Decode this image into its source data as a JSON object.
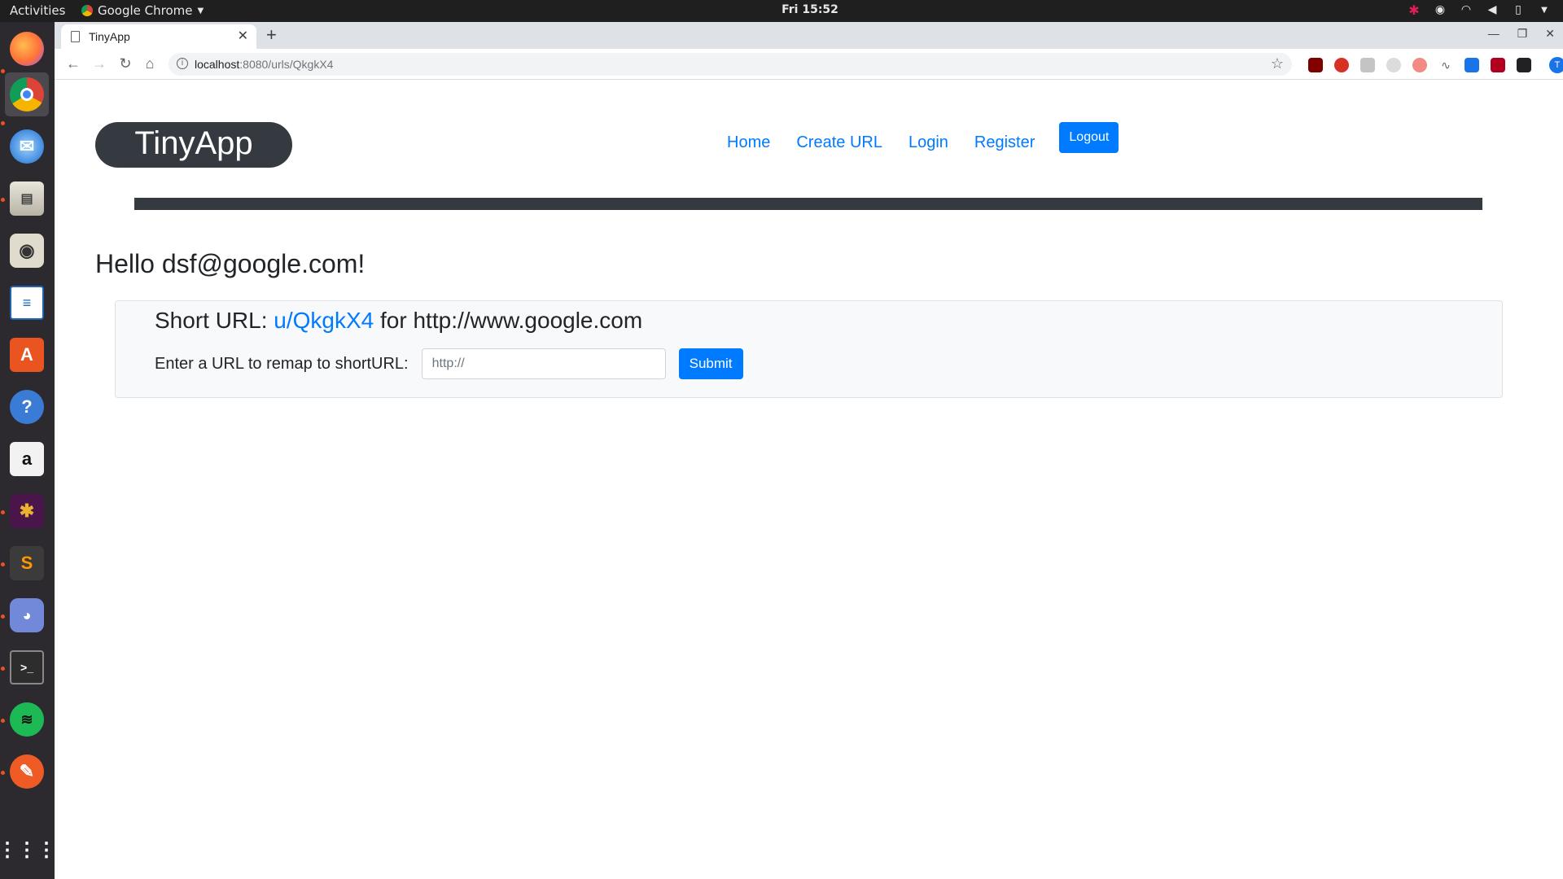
{
  "topbar": {
    "activities": "Activities",
    "app_name": "Google Chrome",
    "clock": "Fri 15:52"
  },
  "dock": {
    "apps": [
      "firefox",
      "chrome",
      "thunderbird",
      "files",
      "rhythmbox",
      "libreoffice-writer",
      "software-center",
      "help",
      "amazon",
      "slack",
      "sublime-text",
      "discord",
      "terminal",
      "spotify",
      "postman",
      "show-applications"
    ]
  },
  "browser": {
    "tab_title": "TinyApp",
    "url_host": "localhost",
    "url_rest": ":8080/urls/QkgkX4",
    "avatar_letter": "T"
  },
  "page": {
    "brand": "TinyApp",
    "nav": {
      "home": "Home",
      "create_url": "Create URL",
      "login": "Login",
      "register": "Register",
      "logout": "Logout"
    },
    "greeting": "Hello dsf@google.com!",
    "short_url": {
      "prefix": "Short URL:",
      "link": "u/QkgkX4",
      "middle": "for",
      "long_url": "http://www.google.com"
    },
    "remap": {
      "label": "Enter a URL to remap to shortURL:",
      "placeholder": "http://",
      "submit": "Submit"
    }
  },
  "colors": {
    "link": "#007bff",
    "primary_button": "#007bff",
    "brand_bg": "#343a40",
    "card_bg": "#f8f9fa"
  }
}
